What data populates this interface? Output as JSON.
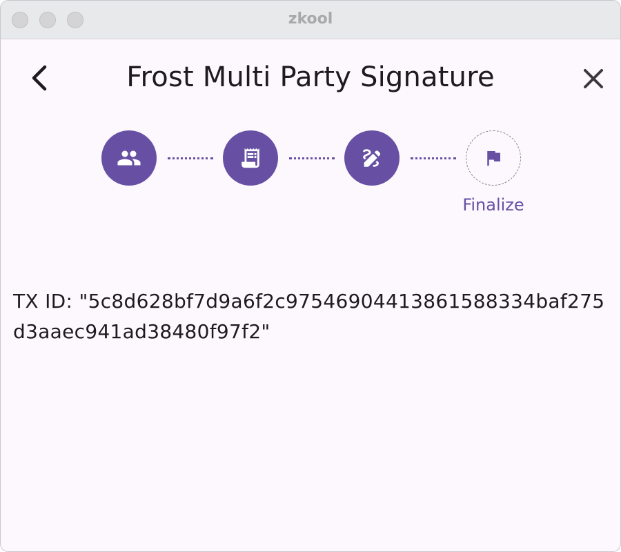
{
  "window": {
    "title": "zkool"
  },
  "appbar": {
    "title": "Frost Multi Party Signature"
  },
  "stepper": {
    "steps": [
      {
        "icon": "group-icon",
        "state": "complete"
      },
      {
        "icon": "receipt-icon",
        "state": "complete"
      },
      {
        "icon": "draw-icon",
        "state": "complete"
      },
      {
        "icon": "flag-icon",
        "state": "current",
        "label": "Finalize"
      }
    ],
    "accent_color": "#6750a4"
  },
  "result": {
    "txid_text": "TX ID: \"5c8d628bf7d9a6f2c97546904413861588334baf275d3aaec941ad38480f97f2\""
  }
}
